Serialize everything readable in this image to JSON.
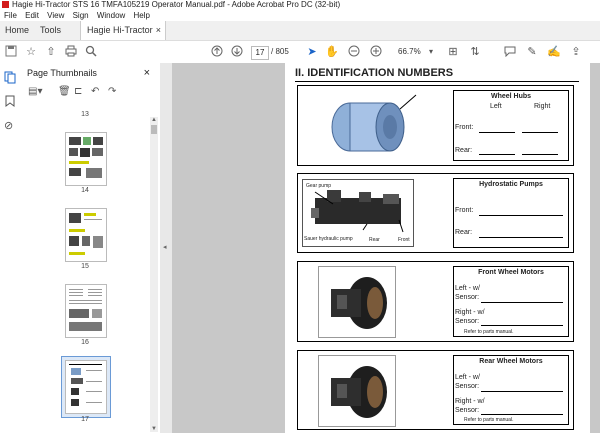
{
  "window": {
    "title": "Hagie Hi-Tractor STS 16 TMFA105219 Operator Manual.pdf - Adobe Acrobat Pro DC (32-bit)"
  },
  "menu": [
    "File",
    "Edit",
    "View",
    "Sign",
    "Window",
    "Help"
  ],
  "tabs": {
    "home": "Home",
    "tools": "Tools",
    "doc": "Hagie Hi-Tractor ST...",
    "doc_close": "×"
  },
  "toolbar": {
    "page_current": "17",
    "page_total": "/ 805",
    "zoom": "66.7%"
  },
  "panel": {
    "title": "Page Thumbnails",
    "close": "×"
  },
  "thumbnails": [
    {
      "label": "13"
    },
    {
      "label": "14"
    },
    {
      "label": "15"
    },
    {
      "label": "16"
    },
    {
      "label": "17",
      "selected": true
    }
  ],
  "document": {
    "section_title": "II.  IDENTIFICATION NUMBERS",
    "wheel_hubs": {
      "title": "Wheel Hubs",
      "col_left": "Left",
      "col_right": "Right",
      "front": "Front:",
      "rear": "Rear:"
    },
    "pumps": {
      "title": "Hydrostatic Pumps",
      "front": "Front:",
      "rear": "Rear:",
      "cap_gear": "Gear pump",
      "cap_sauer": "Sauer hydraulic pump",
      "cap_rear": "Rear",
      "cap_front": "Front"
    },
    "front_motors": {
      "title": "Front Wheel Motors",
      "left": "Left - w/",
      "left2": "Sensor:",
      "right": "Right - w/",
      "right2": "Sensor:",
      "note": "Refer to parts manual."
    },
    "rear_motors": {
      "title": "Rear Wheel Motors",
      "left": "Left - w/",
      "left2": "Sensor:",
      "right": "Right - w/",
      "right2": "Sensor:",
      "note": "Refer to parts manual."
    }
  }
}
